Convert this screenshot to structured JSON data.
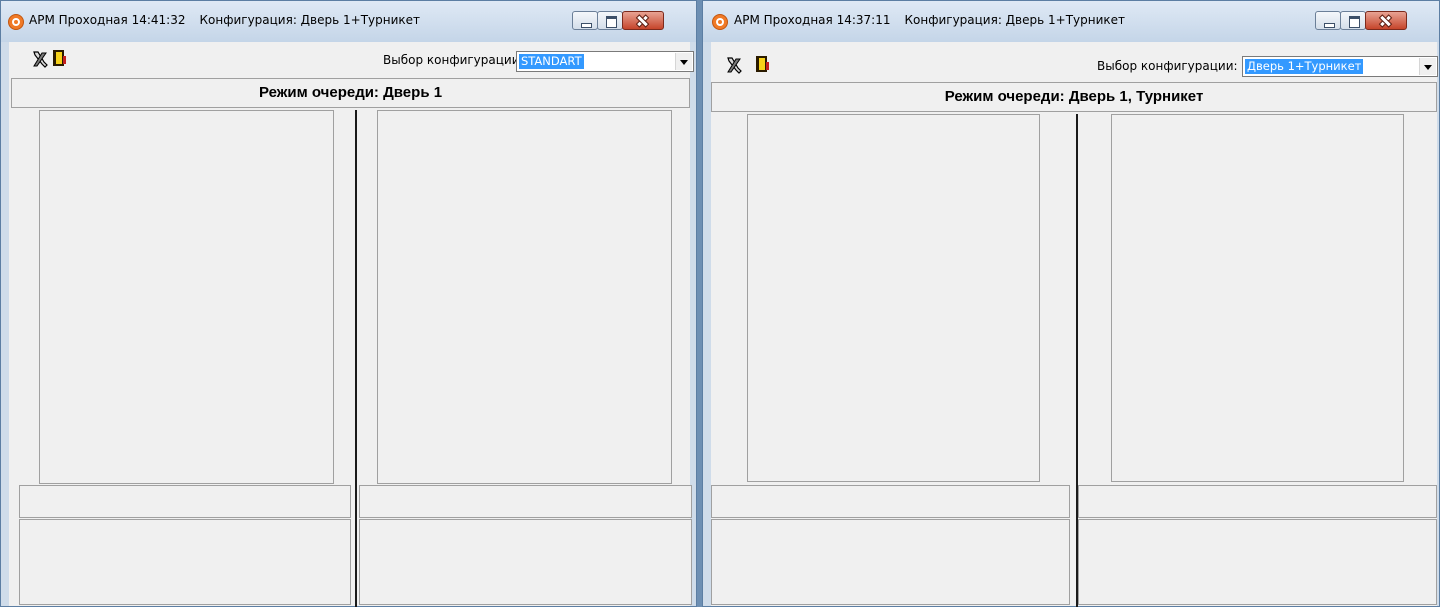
{
  "windows": [
    {
      "title": {
        "app": "АРМ Проходная",
        "time": "14:41:32",
        "config": "Конфигурация: Дверь 1+Турникет"
      },
      "toolbar": {
        "tools_icon": "tools-icon",
        "exit_icon": "exit-door-icon",
        "config_label": "Выбор конфигурации:",
        "config_value": "STANDART"
      },
      "mode_header": "Режим очереди: Дверь 1"
    },
    {
      "title": {
        "app": "АРМ Проходная",
        "time": "14:37:11",
        "config": "Конфигурация: Дверь 1+Турникет"
      },
      "toolbar": {
        "tools_icon": "tools-icon",
        "exit_icon": "exit-door-icon",
        "config_label": "Выбор конфигурации:",
        "config_value": "Дверь 1+Турникет"
      },
      "mode_header": "Режим очереди: Дверь 1, Турникет"
    }
  ],
  "colors": {
    "selection": "#3399ff",
    "window_bg": "#f0f0f0",
    "close_button": "#c6452b",
    "app_icon": "#f07a27"
  }
}
